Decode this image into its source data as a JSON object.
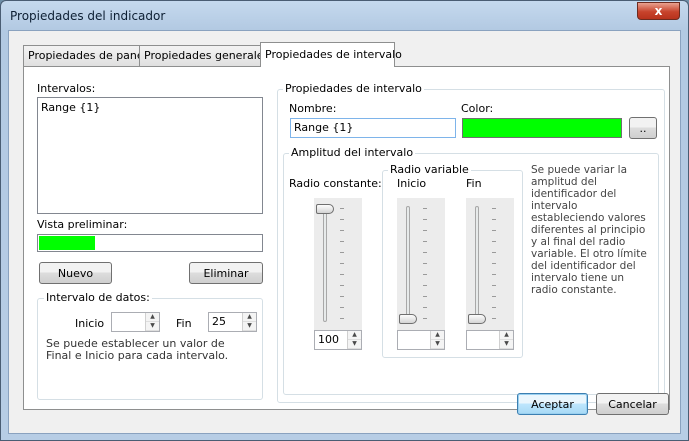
{
  "window": {
    "title": "Propiedades del indicador",
    "close_label": "x"
  },
  "tabs": [
    {
      "label": "Propiedades de panel",
      "active": false
    },
    {
      "label": "Propiedades generales",
      "active": false
    },
    {
      "label": "Propiedades de intervalo",
      "active": true
    }
  ],
  "left": {
    "intervals_label": "Intervalos:",
    "intervals": [
      "Range {1}"
    ],
    "preview_label": "Vista preliminar:",
    "preview_fill_fraction": 0.25,
    "preview_color": "#00ff00",
    "new_button": "Nuevo",
    "delete_button": "Eliminar",
    "data_group": {
      "title": "Intervalo de datos:",
      "start_label": "Inicio",
      "start_value": "",
      "end_label": "Fin",
      "end_value": "25",
      "note": "Se puede establecer un valor de Final e Inicio para cada intervalo."
    }
  },
  "right": {
    "group_title": "Propiedades de intervalo",
    "name_label": "Nombre:",
    "name_value": "Range {1}",
    "color_label": "Color:",
    "color_value": "#00ff00",
    "color_button": "..",
    "amplitude": {
      "title": "Amplitud del intervalo",
      "constant_label": "Radio constante:",
      "constant_value": "100",
      "constant_level": 1.0,
      "variable_title": "Radio variable",
      "variable_start_label": "Inicio",
      "variable_start_value": "",
      "variable_start_level": 0.0,
      "variable_end_label": "Fin",
      "variable_end_value": "",
      "variable_end_level": 0.0,
      "description": "Se puede variar la amplitud del identificador del intervalo estableciendo valores diferentes al principio y al final del radio variable. El otro límite del identificador del intervalo tiene un radio constante."
    }
  },
  "footer": {
    "accept_button": "Aceptar",
    "cancel_button": "Cancelar"
  },
  "spin_arrows": {
    "up": "▲",
    "down": "▼"
  }
}
